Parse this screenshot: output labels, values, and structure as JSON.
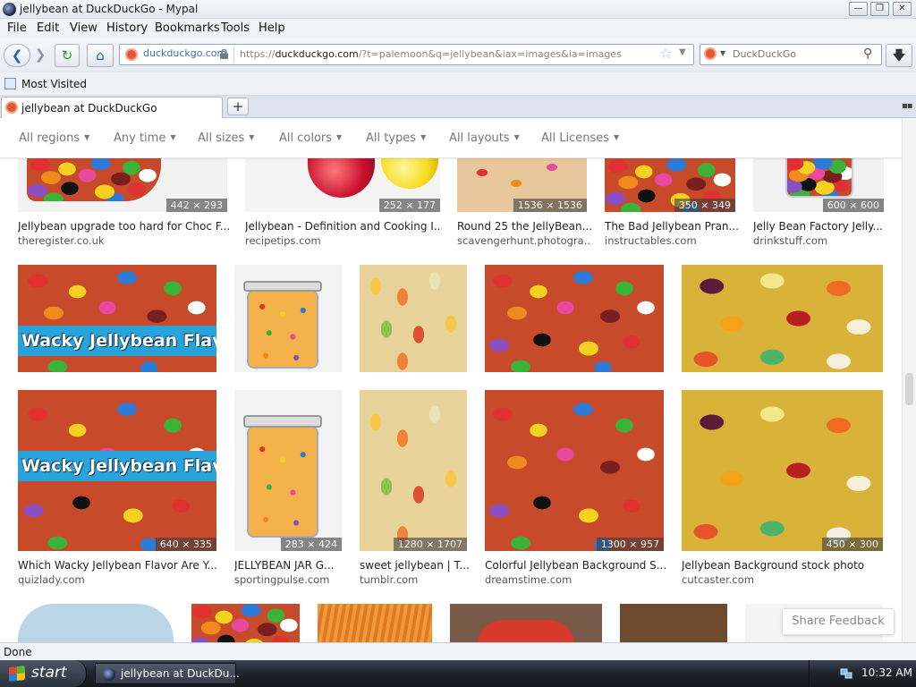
{
  "window": {
    "title": "jellybean at DuckDuckGo - Mypal",
    "buttons": [
      "—",
      "❐",
      "✕"
    ]
  },
  "menu": [
    "File",
    "Edit",
    "View",
    "History",
    "Bookmarks",
    "Tools",
    "Help"
  ],
  "navbar": {
    "identity_domain": "duckduckgo.com",
    "url_prefix": "https://",
    "url_host": "duckduckgo.com",
    "url_rest": "/?t=palemoon&q=jellybean&iax=images&ia=images",
    "search_placeholder": "DuckDuckGo"
  },
  "bookmarks": {
    "most_visited": "Most Visited"
  },
  "tabs": [
    {
      "label": "jellybean at DuckDuckGo"
    }
  ],
  "filters": [
    "All regions",
    "Any time",
    "All sizes",
    "All colors",
    "All types",
    "All layouts",
    "All Licenses"
  ],
  "results": {
    "row1": [
      {
        "dims": "442 × 293",
        "caption": "Jellybean upgrade too hard for Choc F...",
        "source": "theregister.co.uk"
      },
      {
        "dims": "252 × 177",
        "caption": "Jellybean - Definition and Cooking I...",
        "source": "recipetips.com"
      },
      {
        "dims": "1536 × 1536",
        "caption": "Round 25 the JellyBean...",
        "source": "scavengerhunt.photogra..."
      },
      {
        "dims": "350 × 349",
        "caption": "The Bad Jellybean Pran...",
        "source": "instructables.com"
      },
      {
        "dims": "600 × 600",
        "caption": "Jelly Bean Factory Jelly...",
        "source": "drinkstuff.com"
      }
    ],
    "banner_text": "Wacky Jellybean Flavor Are",
    "row3": [
      {
        "dims": "640 × 335",
        "caption": "Which Wacky Jellybean Flavor Are Y...",
        "source": "quizlady.com"
      },
      {
        "dims": "283 × 424",
        "caption": "JELLYBEAN JAR G...",
        "source": "sportingpulse.com"
      },
      {
        "dims": "1280 × 1707",
        "caption": "sweet jellybean | T...",
        "source": "tumblr.com"
      },
      {
        "dims": "1300 × 957",
        "caption": "Colorful Jellybean Background S...",
        "source": "dreamstime.com"
      },
      {
        "dims": "450 × 300",
        "caption": "Jellybean Background stock photo",
        "source": "cutcaster.com"
      }
    ]
  },
  "feedback": "Share Feedback",
  "status": "Done",
  "taskbar": {
    "start": "start",
    "task": "jellybean at DuckDu...",
    "clock": "10:32 AM"
  }
}
